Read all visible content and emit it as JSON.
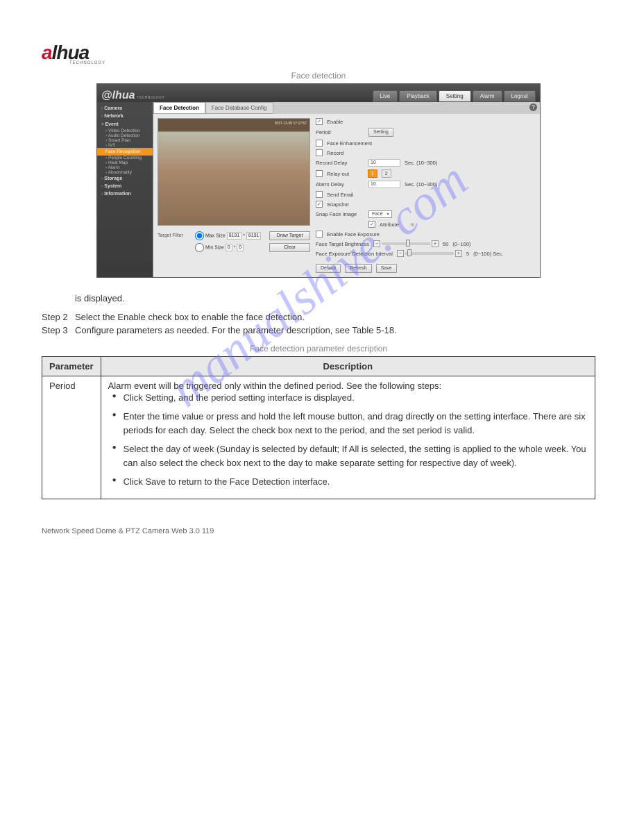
{
  "logo": {
    "part1": "a",
    "part2": "lhua",
    "sub": "TECHNOLOGY"
  },
  "figure_label": "Face detection",
  "nav": [
    "Live",
    "Playback",
    "Setting",
    "Alarm",
    "Logout"
  ],
  "nav_active": "Setting",
  "sidebar": {
    "top": [
      "Camera",
      "Network",
      "Event"
    ],
    "event_subs": [
      "Video Detection",
      "Audio Detection",
      "Smart Plan",
      "IVS"
    ],
    "active": "Face Recognition",
    "after": [
      "People Counting",
      "Heat Map",
      "Alarm",
      "Abnormality"
    ],
    "bottom": [
      "Storage",
      "System",
      "Information"
    ]
  },
  "tabs": {
    "active": "Face Detection",
    "other": "Face Database Config"
  },
  "preview_stamp": "2017-12-05 17:17:57",
  "target_filter": {
    "label": "Target Filter",
    "max": "Max Size",
    "max_w": "8191",
    "max_h": "8191",
    "min": "Min Size",
    "min_w": "0",
    "min_h": "0",
    "draw": "Draw Target",
    "clear": "Clear"
  },
  "settings": {
    "enable": "Enable",
    "period": "Period",
    "period_btn": "Setting",
    "face_enh": "Face Enhancement",
    "record": "Record",
    "record_delay": "Record Delay",
    "record_delay_val": "10",
    "record_delay_hint": "Sec. (10~300)",
    "relay_out": "Relay-out",
    "relay1": "1",
    "relay2": "2",
    "alarm_delay": "Alarm Delay",
    "alarm_delay_val": "10",
    "alarm_delay_hint": "Sec. (10~300)",
    "send_email": "Send Email",
    "snapshot": "Snapshot",
    "snap_face": "Snap Face Image",
    "snap_face_val": "Face",
    "attribute": "Attribute",
    "enable_exp": "Enable Face Exposure",
    "face_target_b": "Face Target Brightness",
    "ftb_val": "50",
    "ftb_range": "(0~100)",
    "face_exp_int": "Face Exposure Detection Interval",
    "fei_val": "5",
    "fei_range": "(0~100) Sec.",
    "default": "Default",
    "refresh": "Refresh",
    "save": "Save"
  },
  "intro": "is displayed.",
  "step2_num": "Step 2",
  "step2": "Select the Enable check box to enable the face detection.",
  "step3_num": "Step 3",
  "step3": "Configure parameters as needed. For the parameter description, see Table 5-18.",
  "table_title": "Face detection parameter description",
  "table_header_param": "Parameter",
  "table_header_desc": "Description",
  "param_period": "Period",
  "period_desc_intro": "Alarm event will be triggered only within the defined period. See the following steps:",
  "period_desc_1a": "Click Setting, and the period setting interface is displayed.",
  "period_desc_1b": "Enter the time value or press and hold the left mouse button, and drag directly on the setting interface. There are six periods for each day. Select the check box next to the period, and the set period is valid.",
  "period_desc_1c": "Select the day of week (Sunday is selected by default; If All is selected, the setting is applied to the whole week. You can also select the check box next to the day to make separate setting for respective day of week).",
  "period_desc_2": "Click Save to return to the Face Detection interface.",
  "footer": "Network Speed Dome & PTZ Camera Web 3.0  119",
  "watermark": "manualshive. com"
}
